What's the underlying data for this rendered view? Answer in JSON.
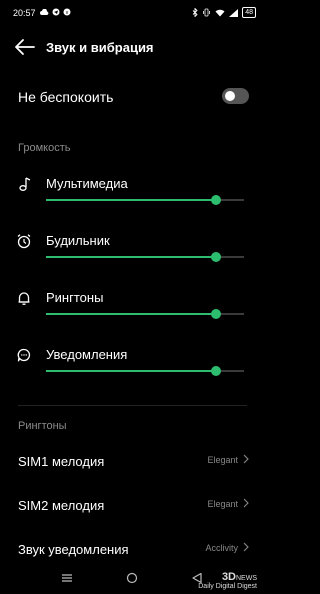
{
  "status": {
    "time": "20:57",
    "battery": "48"
  },
  "header": {
    "title": "Звук и вибрация"
  },
  "dnd": {
    "label": "Не беспокоить",
    "enabled": false
  },
  "volume": {
    "heading": "Громкость",
    "items": [
      {
        "label": "Мультимедиа",
        "icon": "music-note-icon",
        "level": 0.86
      },
      {
        "label": "Будильник",
        "icon": "alarm-clock-icon",
        "level": 0.86
      },
      {
        "label": "Рингтоны",
        "icon": "bell-icon",
        "level": 0.86
      },
      {
        "label": "Уведомления",
        "icon": "chat-bubble-icon",
        "level": 0.86
      }
    ]
  },
  "ringtones": {
    "heading": "Рингтоны",
    "items": [
      {
        "label": "SIM1 мелодия",
        "value": "Elegant"
      },
      {
        "label": "SIM2 мелодия",
        "value": "Elegant"
      },
      {
        "label": "Звук уведомления",
        "value": "Acclivity"
      }
    ]
  },
  "watermark": {
    "line1": "3D",
    "line2": "NEWS",
    "line3": "Daily Digital Digest"
  },
  "colors": {
    "accent": "#2dbd6e",
    "background": "#000000",
    "secondary_text": "#8a8a8a"
  }
}
